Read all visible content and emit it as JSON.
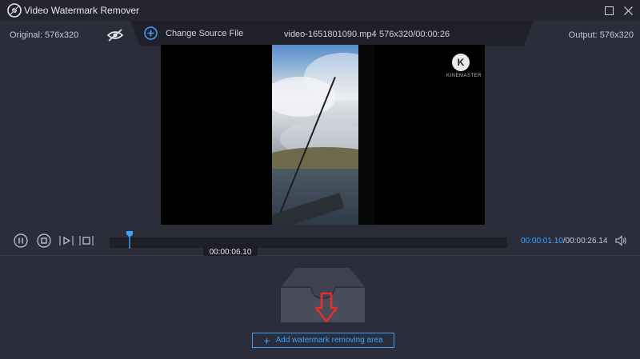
{
  "window": {
    "title": "Video Watermark Remover"
  },
  "infobar": {
    "original_label": "Original: 576x320",
    "change_source_label": "Change Source File",
    "file_name": "video-1651801090.mp4",
    "file_resolution": "576x320/00:00:26",
    "output_label": "Output: 576x320"
  },
  "preview": {
    "watermark_letter": "K",
    "watermark_text": "KINEMASTER"
  },
  "playback": {
    "tooltip_time": "00:00:06.10",
    "current_time": "00:00:01.10",
    "total_time": "/00:00:26.14",
    "progress": 0.05
  },
  "actions": {
    "add_area_label": "Add watermark removing area"
  },
  "colors": {
    "accent": "#3aa3ff",
    "background": "#2b2d3a",
    "titlebar": "#24252f",
    "arrow": "#e03030"
  },
  "icons": [
    "app-logo-icon",
    "maximize-icon",
    "close-icon",
    "eye-slash-icon",
    "plus-circle-icon",
    "pause-icon",
    "stop-icon",
    "play-segment-icon",
    "clip-icon",
    "volume-icon",
    "tray-icon",
    "down-arrow-icon",
    "plus-icon"
  ]
}
